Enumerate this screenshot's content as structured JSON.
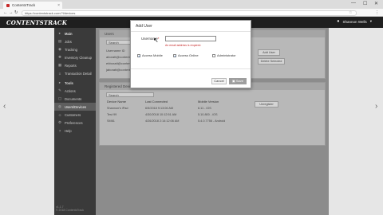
{
  "browser": {
    "tab_title": "ContentsTrack",
    "url": "https://contentstrack.com/?l/devices",
    "win_min": "—",
    "win_max": "☐",
    "win_close": "✕"
  },
  "app": {
    "logo": "CONTENTSTRACK",
    "user_name": "Shannon Wells"
  },
  "sidebar": {
    "section1": "Main",
    "items_a": [
      {
        "label": "Jobs",
        "icon": "▤"
      },
      {
        "label": "Tracking",
        "icon": "◉"
      },
      {
        "label": "Inventory Cleanup",
        "icon": "✚"
      },
      {
        "label": "Reports",
        "icon": "▦"
      },
      {
        "label": "Transaction Detail",
        "icon": "≡"
      }
    ],
    "section2": "Tools",
    "items_b": [
      {
        "label": "Actions",
        "icon": "✎"
      },
      {
        "label": "Documents",
        "icon": "▢"
      },
      {
        "label": "Users/Devices",
        "icon": "◍"
      },
      {
        "label": "Customers",
        "icon": "☺"
      },
      {
        "label": "Preferences",
        "icon": "⚙"
      },
      {
        "label": "Help",
        "icon": "?"
      }
    ],
    "footer": "v1.1.7\n© 2018 ContentsTrack"
  },
  "users_panel": {
    "title": "Users",
    "search_placeholder": "Search",
    "column": "Username ID",
    "rows": [
      "aboratt@contents...",
      "ebboratt@contents...",
      "jaboratt@contents..."
    ],
    "add_label": "Add User",
    "delete_label": "Delete Selected"
  },
  "devices_panel": {
    "title": "Registered Devices",
    "search_placeholder": "Search",
    "headers": [
      "Device Name",
      "Last Connected",
      "Mobile Version"
    ],
    "rows": [
      [
        "Shannon's iPad",
        "6/5/2018 9:13:06 AM",
        "6.11 - iOS"
      ],
      [
        "Test 99",
        "4/30/2018 10:12:51 AM",
        "5.10.800 - iOS"
      ],
      [
        "SM61",
        "4/26/2018 2:14:12:06 AM",
        "5.4.0.7756 - Android"
      ]
    ],
    "delete_label": "Unregister"
  },
  "modal": {
    "title": "Add User",
    "username_label": "Username",
    "required_mark": "*",
    "error": "An email address is required.",
    "checkbox1": "Access Mobile",
    "checkbox2": "Access Online",
    "checkbox3": "Administrator",
    "cancel": "Cancel",
    "save": "Save"
  }
}
